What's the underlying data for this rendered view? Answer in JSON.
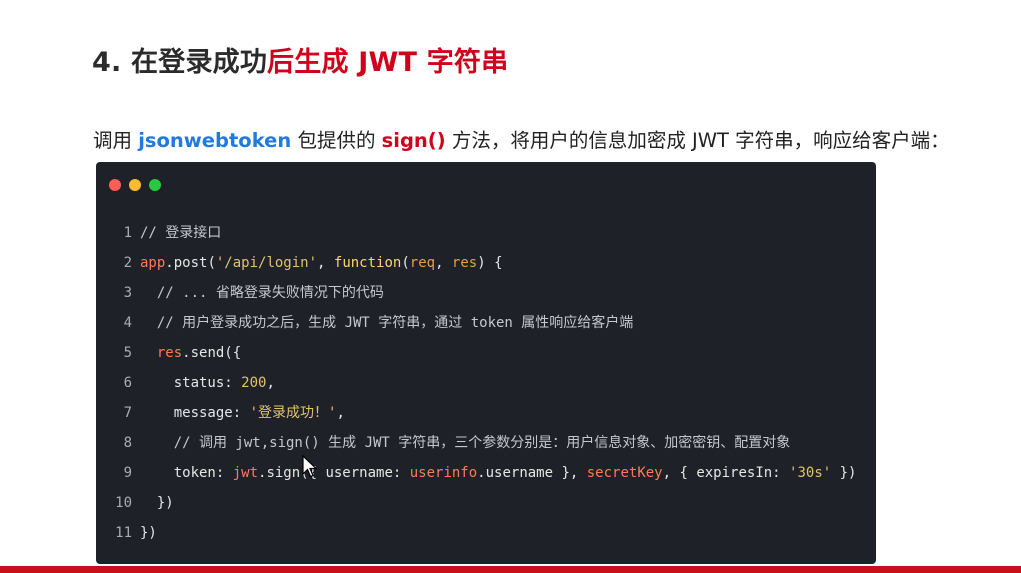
{
  "heading": {
    "prefix": "4. 在登录成功",
    "highlight": "后生成 JWT 字符串"
  },
  "description": {
    "part1": "调用 ",
    "package": "jsonwebtoken",
    "part2": " 包提供的 ",
    "method": "sign()",
    "part3": " 方法，将用户的信息加密成 JWT 字符串，响应给客户端："
  },
  "code_panel": {
    "window_dots": [
      "close-dot",
      "minimize-dot",
      "maximize-dot"
    ],
    "lines": [
      {
        "n": "1",
        "t1": "// 登录接口"
      },
      {
        "n": "2",
        "t1": "app",
        "t2": ".post(",
        "t3": "'/api/login'",
        "t4": ", ",
        "t5": "function",
        "t6": "(",
        "t7": "req",
        "t8": ", ",
        "t9": "res",
        "t10": ") {"
      },
      {
        "n": "3",
        "t1": "  // ... 省略登录失败情况下的代码"
      },
      {
        "n": "4",
        "t1": "  // 用户登录成功之后，生成 JWT 字符串，通过 token 属性响应给客户端"
      },
      {
        "n": "5",
        "t1": "  ",
        "t2": "res",
        "t3": ".send({"
      },
      {
        "n": "6",
        "t1": "    status: ",
        "t2": "200",
        "t3": ","
      },
      {
        "n": "7",
        "t1": "    message: ",
        "t2": "'登录成功！'",
        "t3": ","
      },
      {
        "n": "8",
        "t1": "    // 调用 jwt,sign() 生成 JWT 字符串，三个参数分别是：用户信息对象、加密密钥、配置对象"
      },
      {
        "n": "9",
        "t1": "    token: ",
        "t2": "jwt",
        "t3": ".sign({ username: ",
        "t4": "userinfo",
        "t5": ".username }, ",
        "t6": "secretKey",
        "t7": ", { expiresIn: ",
        "t8": "'30s'",
        "t9": " })"
      },
      {
        "n": "10",
        "t1": "  })"
      },
      {
        "n": "11",
        "t1": "})"
      }
    ]
  },
  "colors": {
    "accent_red": "#d0021b",
    "keyword_blue": "#1f7be0",
    "code_bg": "#1e2128"
  }
}
